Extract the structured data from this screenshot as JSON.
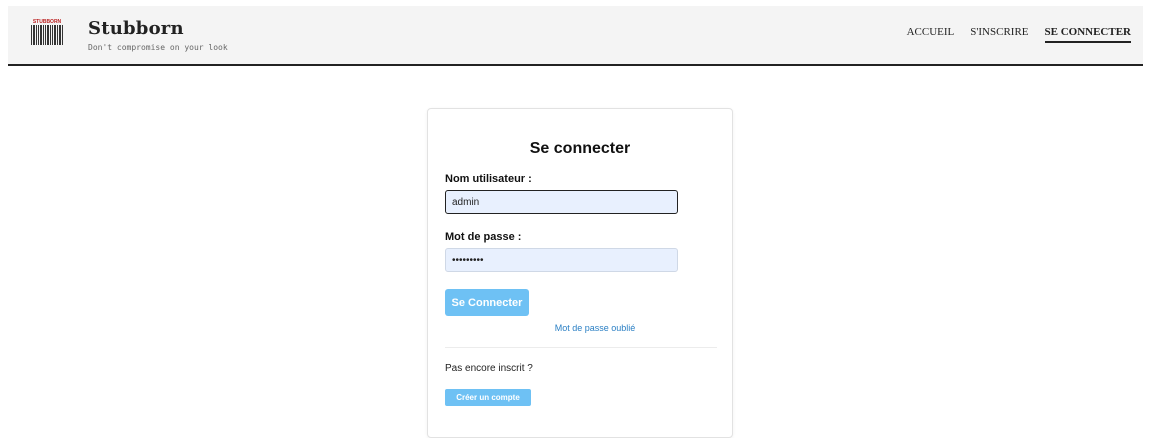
{
  "header": {
    "logo_text": "STUBBORN",
    "brand": "Stubborn",
    "tagline": "Don't compromise on your look",
    "nav": [
      {
        "label": "ACCUEIL"
      },
      {
        "label": "S'INSCRIRE"
      },
      {
        "label": "SE CONNECTER",
        "active": true
      }
    ]
  },
  "login": {
    "title": "Se connecter",
    "username_label": "Nom utilisateur :",
    "username_value": "admin",
    "password_label": "Mot de passe :",
    "password_value": "•••••••••",
    "submit_label": "Se Connecter",
    "forgot_link": "Mot de passe oublié",
    "not_registered": "Pas encore inscrit ?",
    "create_account_label": "Créer un compte"
  },
  "colors": {
    "header_bg": "#f4f4f4",
    "button_bg": "#6ec1f4",
    "link": "#2a7fc4",
    "input_bg": "#e8f0fe"
  }
}
